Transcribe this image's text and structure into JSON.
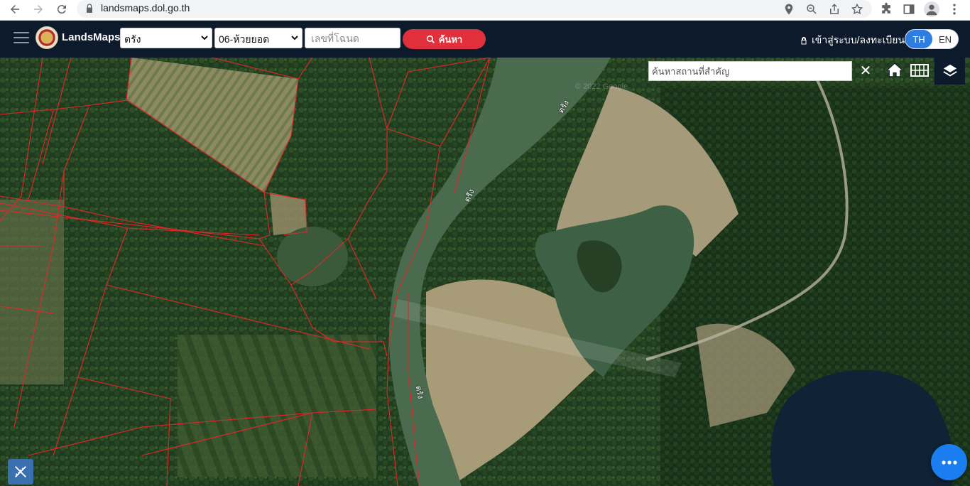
{
  "browser": {
    "url": "landsmaps.dol.go.th",
    "icons": [
      "back-icon",
      "forward-icon",
      "reload-icon",
      "lock-icon",
      "location-icon",
      "zoom-out-icon",
      "share-icon",
      "star-icon",
      "extensions-icon",
      "sidebar-icon",
      "profile-icon",
      "kebab-icon"
    ]
  },
  "header": {
    "brand": "LandsMaps",
    "province": "ตรัง",
    "district": "06-ห้วยยอด",
    "deed_placeholder": "เลขที่โฉนด",
    "search_label": "ค้นหา",
    "login_label": "เข้าสู่ระบบ/ลงทะเบียน",
    "lang_th": "TH",
    "lang_en": "EN"
  },
  "map": {
    "place_search_placeholder": "ค้นหาสถานที่สำคัญ",
    "clear_label": "✕",
    "watermark": "© 2022 Google",
    "river_labels": [
      "ตรัง",
      "ตรัง",
      "ตรัง"
    ],
    "parcel_color": "#e8242a",
    "accent": "#1a7ef0"
  }
}
